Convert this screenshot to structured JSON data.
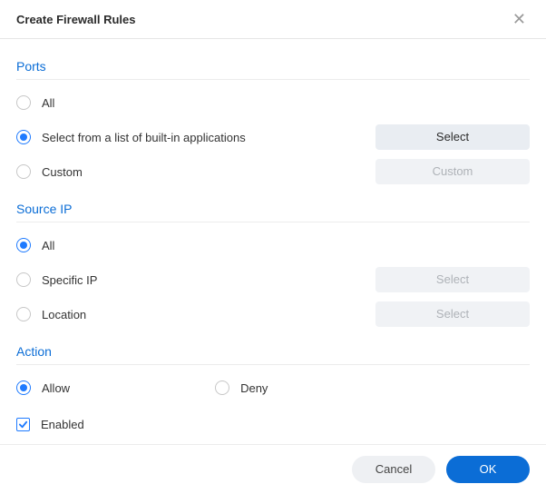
{
  "header": {
    "title": "Create Firewall Rules"
  },
  "ports": {
    "title": "Ports",
    "all": "All",
    "builtin": "Select from a list of built-in applications",
    "custom": "Custom",
    "select_btn": "Select",
    "custom_btn": "Custom",
    "selected": "builtin"
  },
  "source_ip": {
    "title": "Source IP",
    "all": "All",
    "specific": "Specific IP",
    "location": "Location",
    "select_btn": "Select",
    "selected": "all"
  },
  "action": {
    "title": "Action",
    "allow": "Allow",
    "deny": "Deny",
    "selected": "allow"
  },
  "enabled": {
    "label": "Enabled",
    "checked": true
  },
  "footer": {
    "cancel": "Cancel",
    "ok": "OK"
  }
}
